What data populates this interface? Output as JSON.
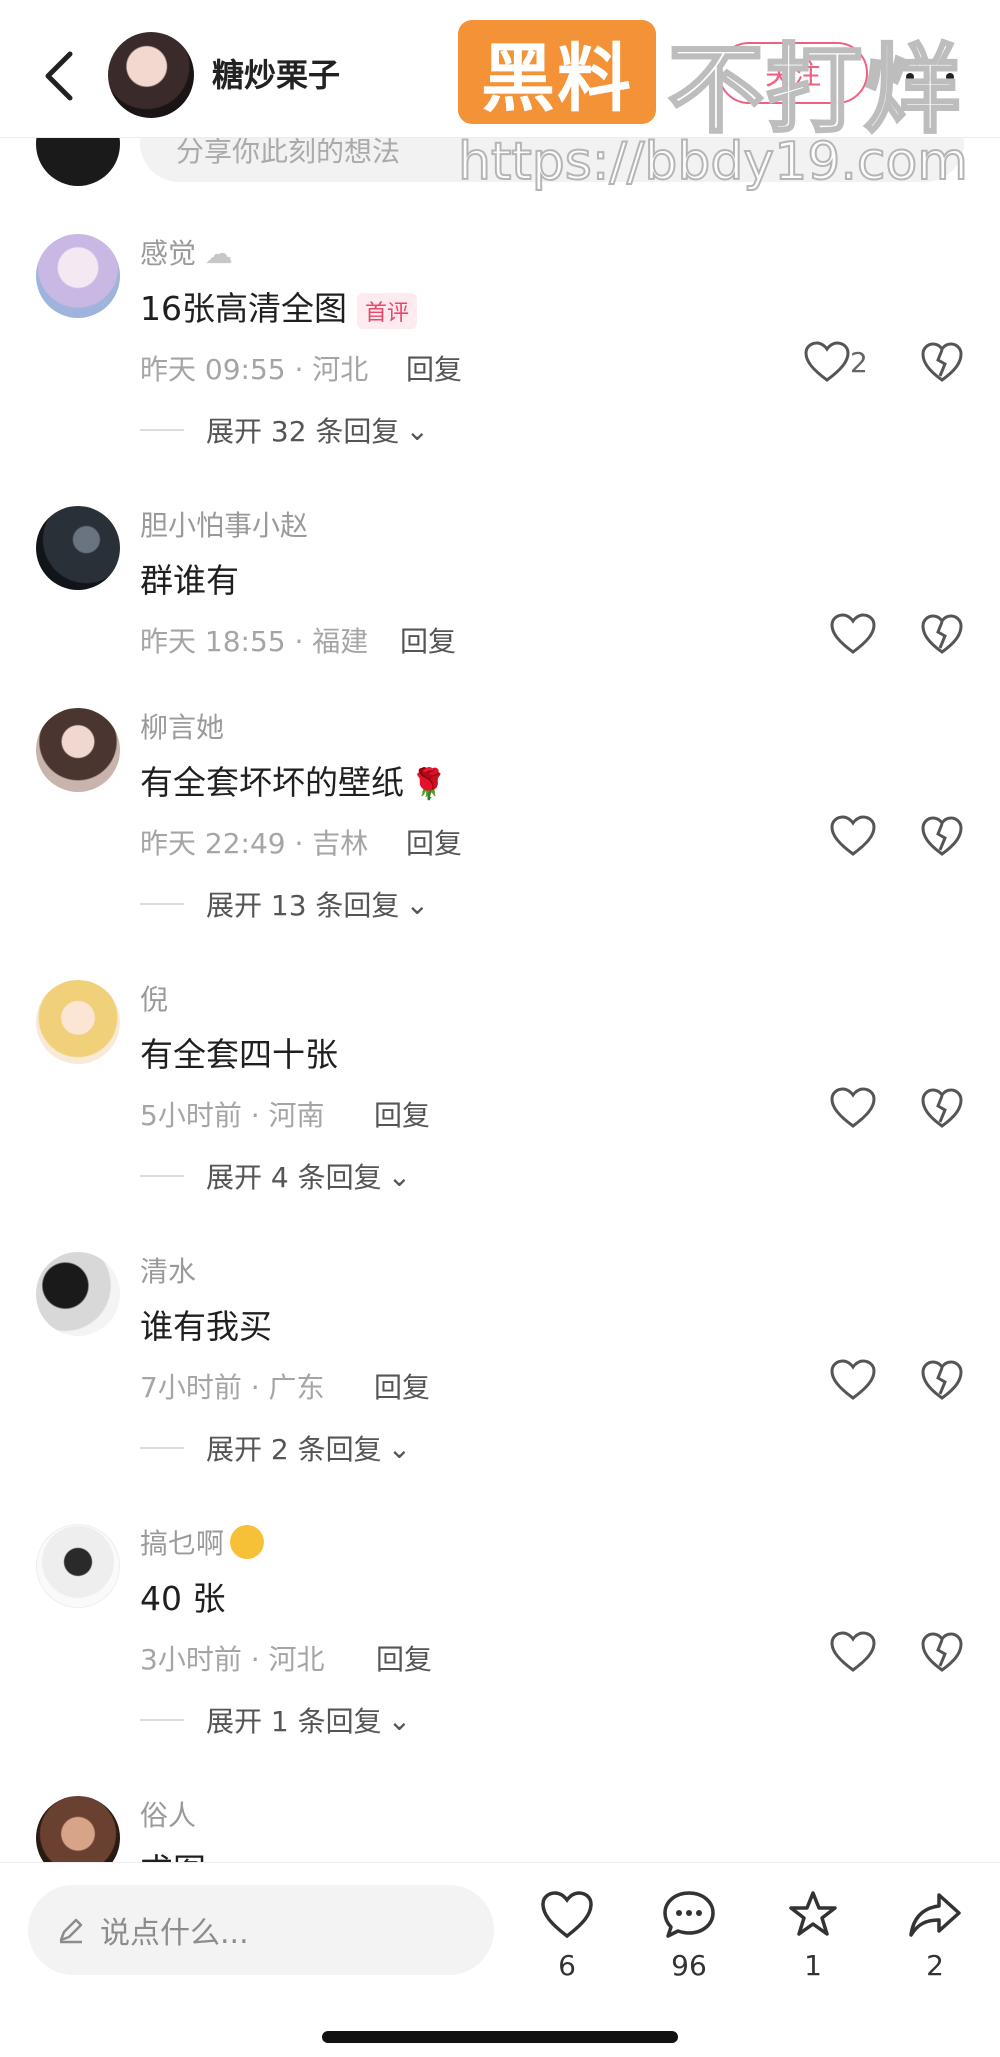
{
  "header": {
    "author_name": "糖炒栗子",
    "follow_label": "关注"
  },
  "watermark": {
    "badge": "黑料",
    "text": "不打烊",
    "url": "https://bbdy19.com"
  },
  "share": {
    "placeholder": "分享你此刻的想法"
  },
  "comments": [
    {
      "user": "感觉",
      "text": "16张高清全图",
      "badge": "首评",
      "meta": "昨天 09:55 · 河北",
      "reply": "回复",
      "likes": "2",
      "expand": "展开 32 条回复"
    },
    {
      "user": "胆小怕事小赵",
      "text": "群谁有",
      "meta": "昨天 18:55 · 福建",
      "reply": "回复"
    },
    {
      "user": "柳言她",
      "text": "有全套坏坏的壁纸",
      "meta": "昨天 22:49 · 吉林",
      "reply": "回复",
      "expand": "展开 13 条回复"
    },
    {
      "user": "倪",
      "text": "有全套四十张",
      "meta": "5小时前 · 河南",
      "reply": "回复",
      "expand": "展开 4 条回复"
    },
    {
      "user": "清水",
      "text": "谁有我买",
      "meta": "7小时前 · 广东",
      "reply": "回复",
      "expand": "展开 2 条回复"
    },
    {
      "user": "搞乜啊",
      "text": "40 张",
      "meta": "3小时前 · 河北",
      "reply": "回复",
      "expand": "展开 1 条回复"
    },
    {
      "user": "俗人",
      "text": "求图"
    }
  ],
  "bottom": {
    "input_placeholder": "说点什么...",
    "likes": "6",
    "comments": "96",
    "favorites": "1",
    "shares": "2"
  },
  "colors": {
    "accent": "#f06080",
    "watermark_orange": "#f39237"
  }
}
